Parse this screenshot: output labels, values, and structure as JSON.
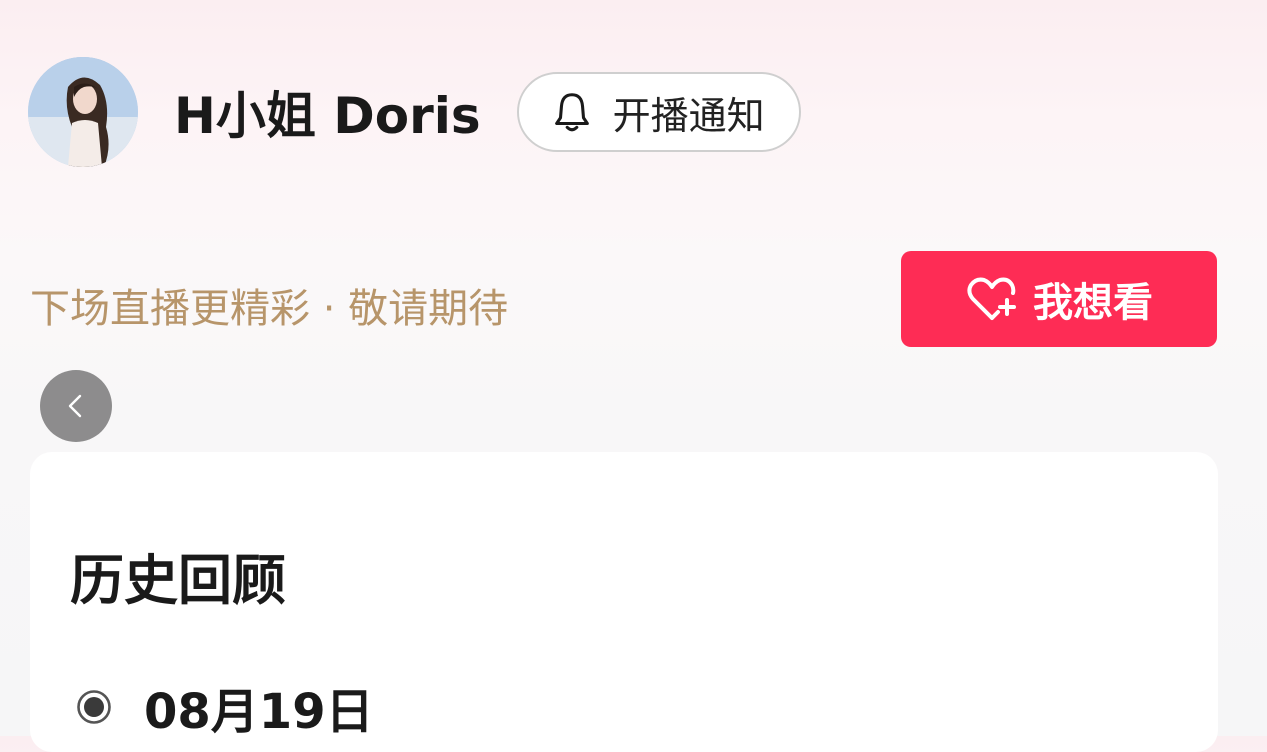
{
  "streamer": {
    "name": "H小姐 Doris"
  },
  "notify_button": {
    "icon": "bell-icon",
    "label": "开播通知"
  },
  "teaser": {
    "text": "下场直播更精彩 · 敬请期待"
  },
  "want_button": {
    "icon": "heart-plus-icon",
    "label": "我想看",
    "color": "#fe2c55"
  },
  "back_button": {
    "icon": "chevron-left-icon"
  },
  "history": {
    "title": "历史回顾",
    "entries": [
      {
        "date": "08月19日",
        "selected": true
      }
    ]
  },
  "colors": {
    "teaser_text": "#b7956a",
    "accent": "#fe2c55"
  }
}
